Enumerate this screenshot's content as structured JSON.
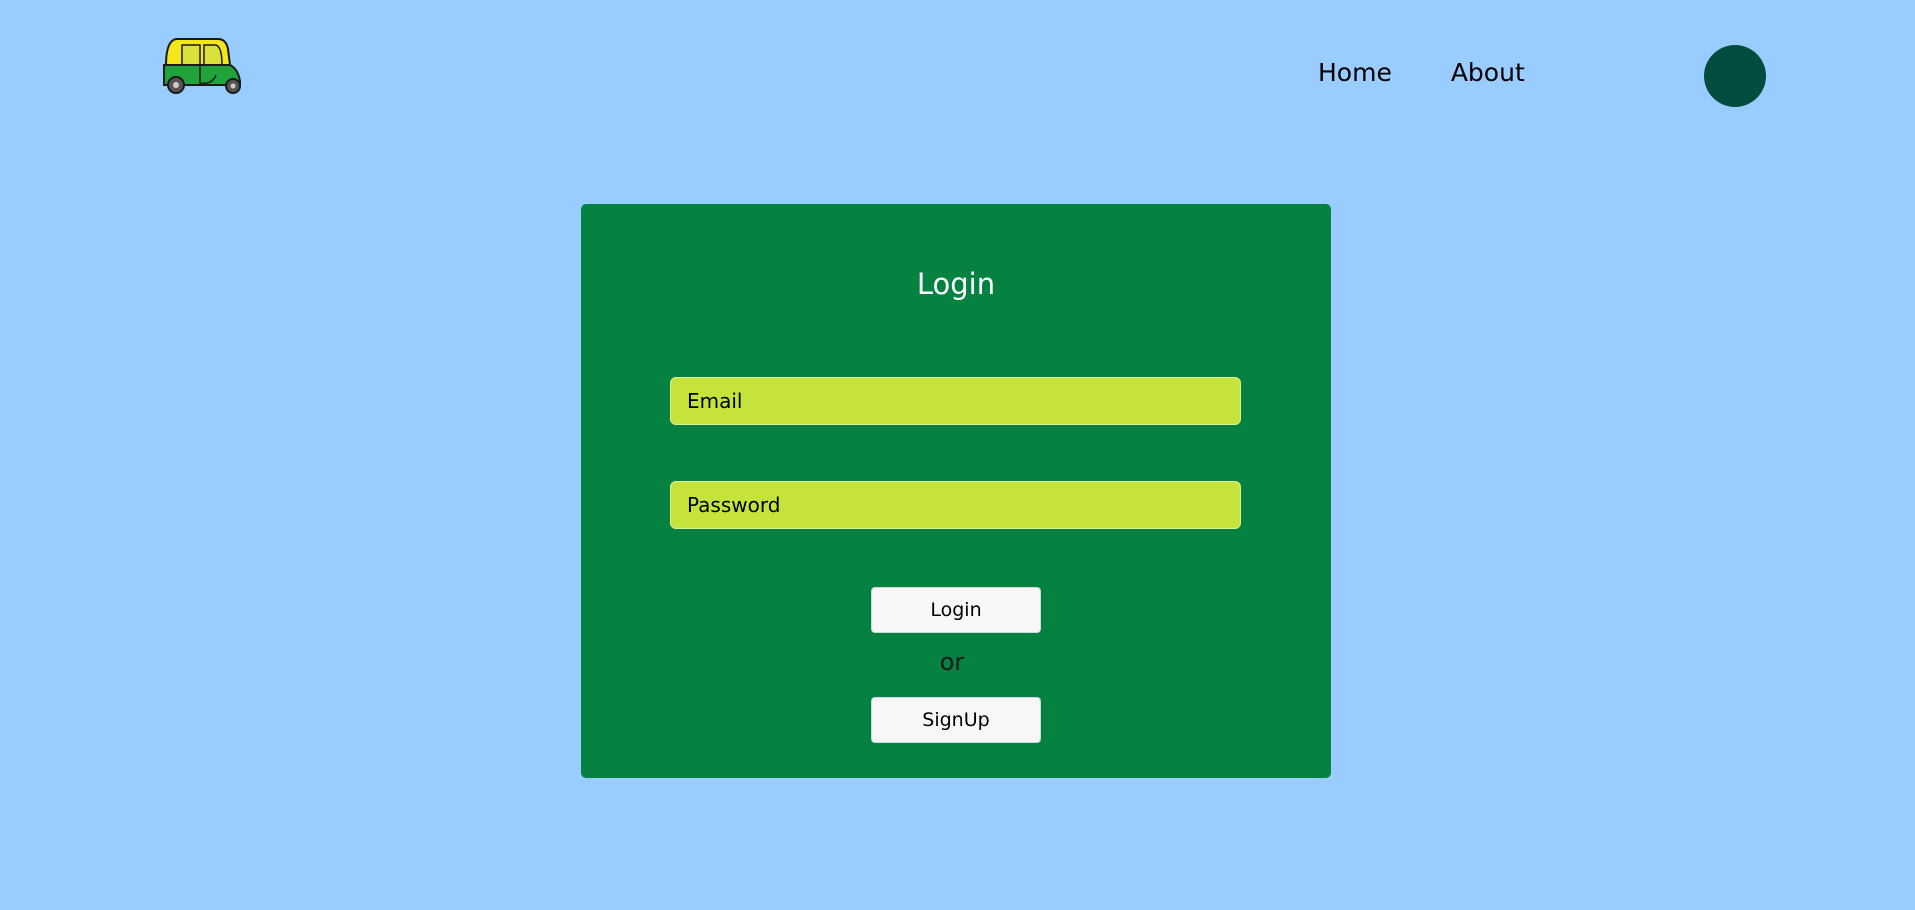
{
  "header": {
    "logo_icon": "auto-rickshaw-icon",
    "nav": {
      "home_label": "Home",
      "about_label": "About"
    },
    "avatar_color": "#004d40"
  },
  "login_card": {
    "title": "Login",
    "email_placeholder": "Email",
    "email_value": "",
    "password_placeholder": "Password",
    "password_value": "",
    "login_button_label": "Login",
    "separator_text": "or",
    "signup_button_label": "SignUp"
  },
  "colors": {
    "background": "#99ccff",
    "card": "#058142",
    "input_fill": "#c5e33b",
    "button_fill": "#f7f7f7"
  }
}
